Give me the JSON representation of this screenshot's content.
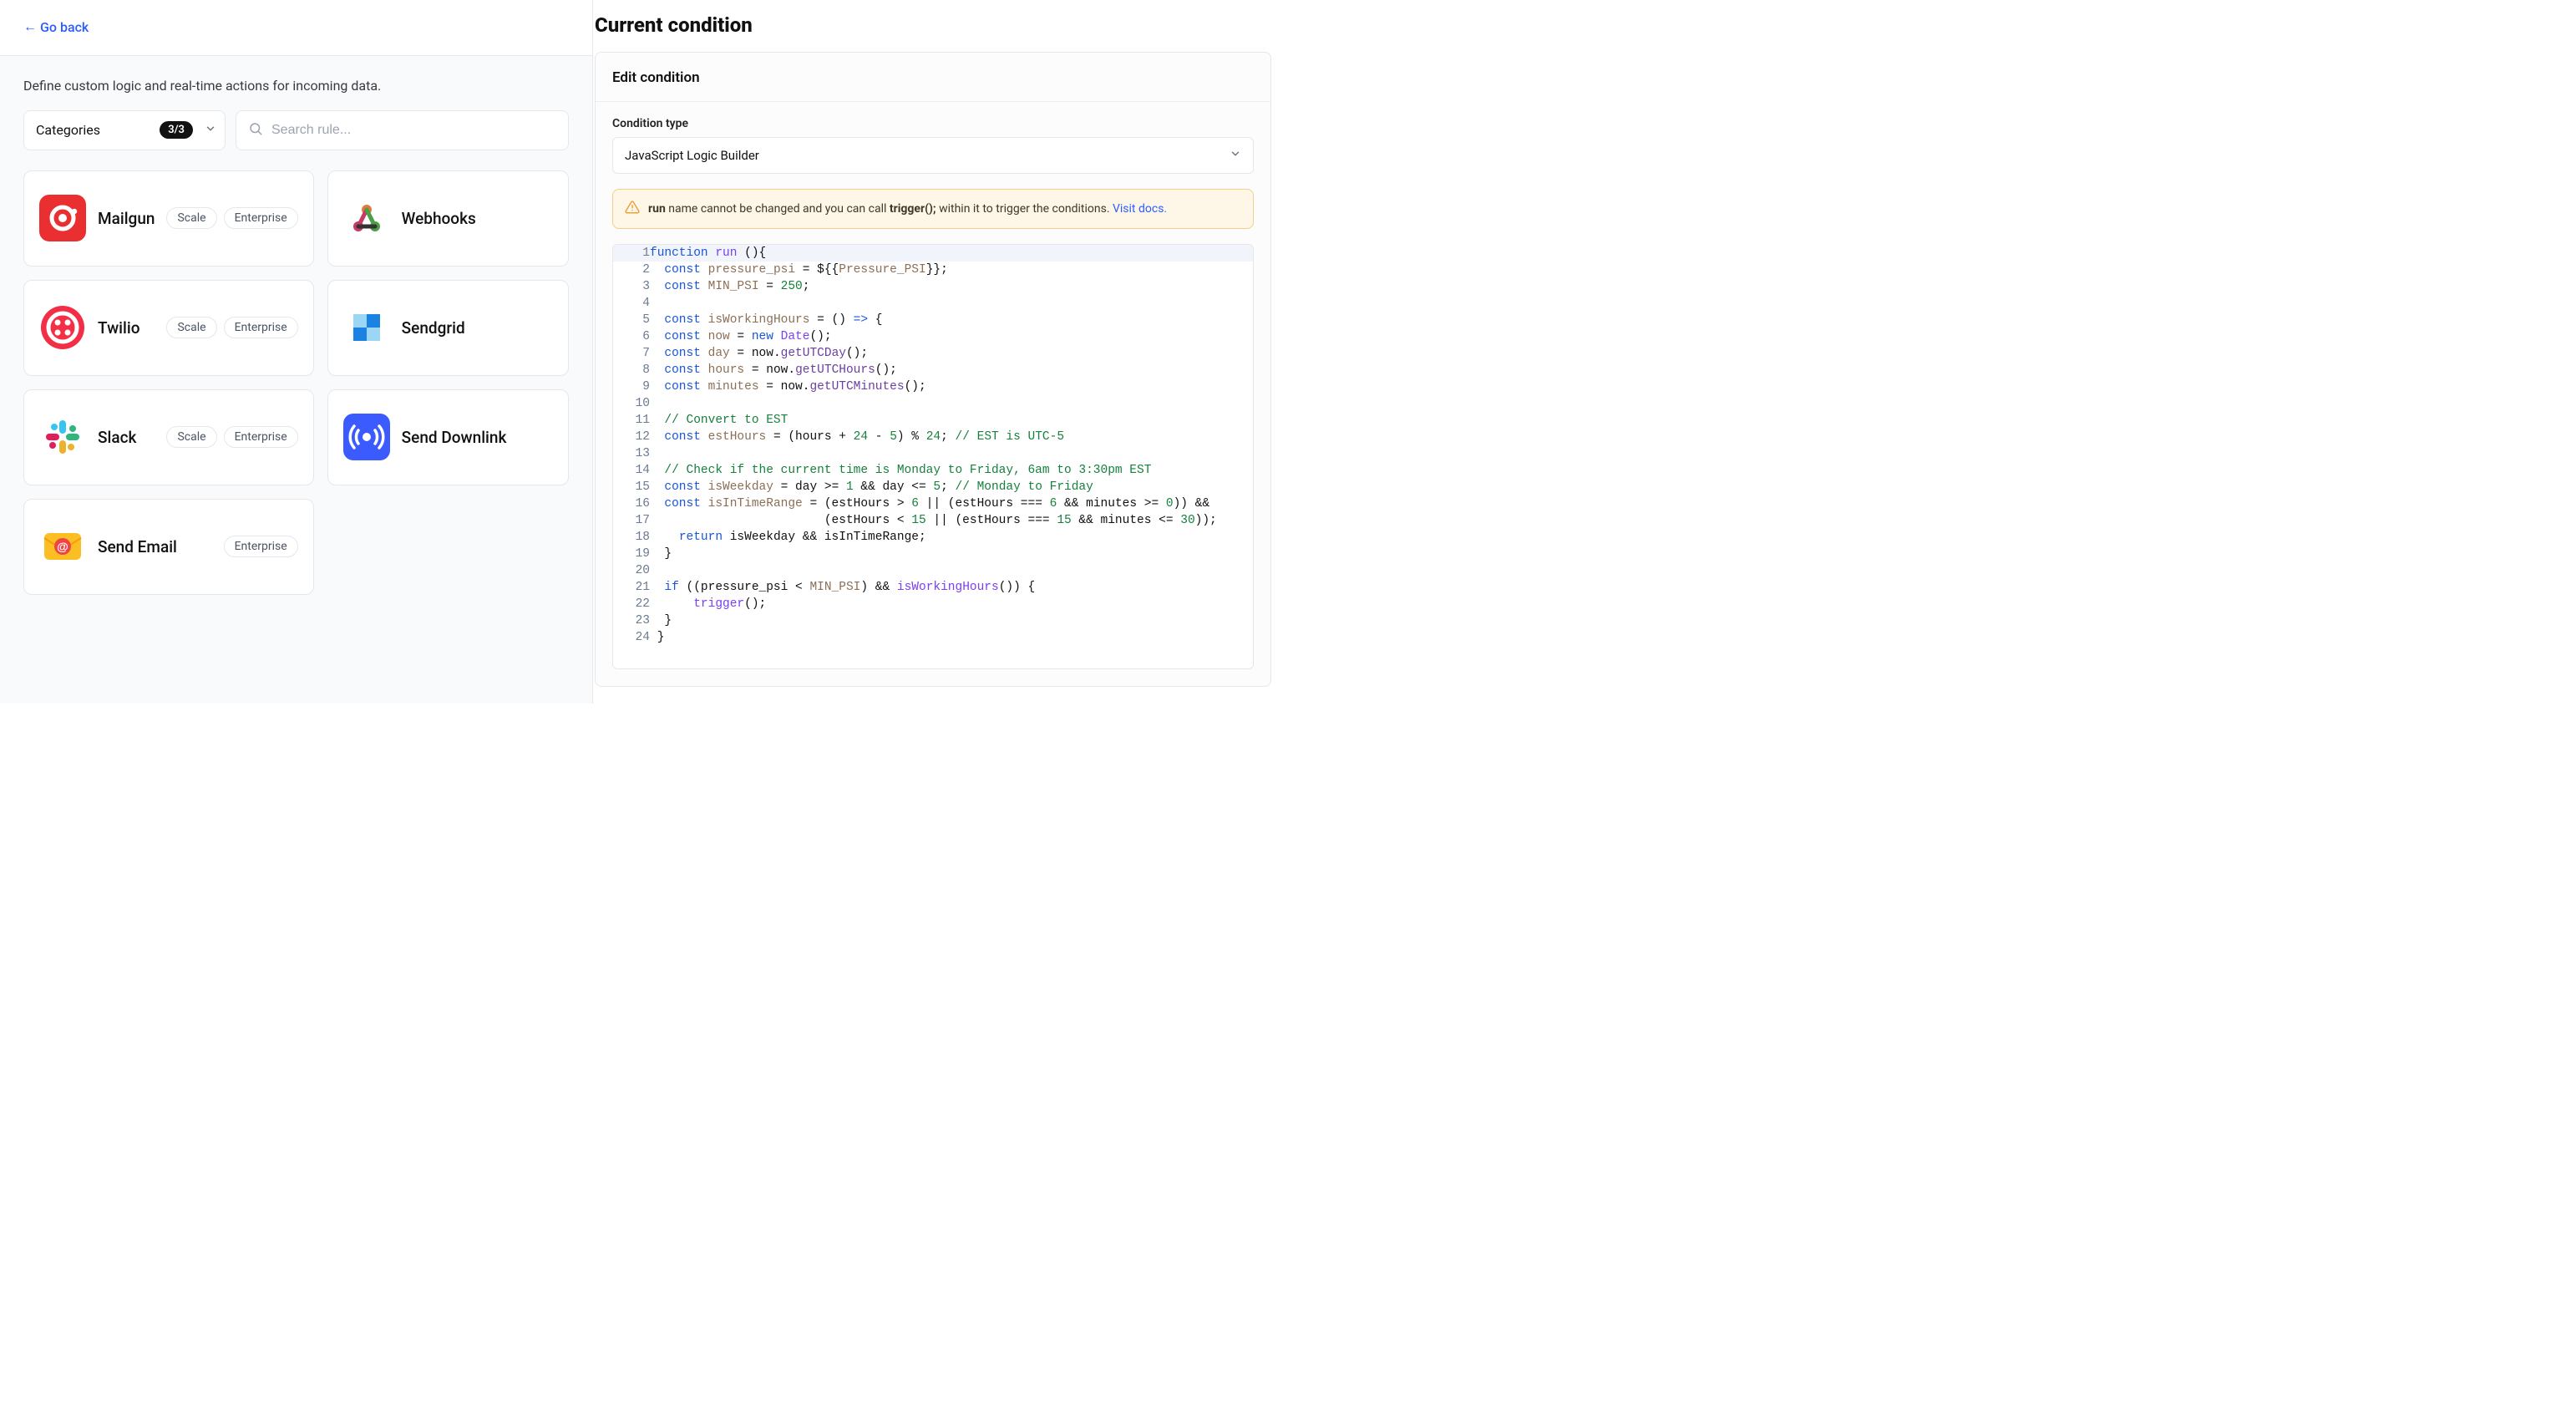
{
  "left": {
    "go_back": "Go back",
    "subtitle": "Define custom logic and real-time actions for incoming data.",
    "categories_label": "Categories",
    "categories_badge": "3/3",
    "search_placeholder": "Search rule...",
    "tags": {
      "scale": "Scale",
      "enterprise": "Enterprise"
    },
    "cards": [
      {
        "name": "Mailgun",
        "scale": true,
        "enterprise": true
      },
      {
        "name": "Webhooks",
        "scale": false,
        "enterprise": false
      },
      {
        "name": "Twilio",
        "scale": true,
        "enterprise": true
      },
      {
        "name": "Sendgrid",
        "scale": false,
        "enterprise": false
      },
      {
        "name": "Slack",
        "scale": true,
        "enterprise": true
      },
      {
        "name": "Send Downlink",
        "scale": false,
        "enterprise": false
      },
      {
        "name": "Send Email",
        "scale": false,
        "enterprise": true
      }
    ]
  },
  "right": {
    "title": "Current condition",
    "panel_header": "Edit condition",
    "condition_type_label": "Condition type",
    "condition_type_value": "JavaScript Logic Builder",
    "alert": {
      "pre": "run",
      "mid1": " name cannot be changed and you can call ",
      "bold2": "trigger();",
      "mid2": " within it to trigger the conditions. ",
      "link": "Visit docs."
    },
    "code_lines": [
      {
        "n": 1,
        "hl": true,
        "seg": [
          [
            "kw",
            "function"
          ],
          [
            "",
            " "
          ],
          [
            "fn",
            "run"
          ],
          [
            "",
            " (){"
          ]
        ]
      },
      {
        "n": 2,
        "seg": [
          [
            "",
            "  "
          ],
          [
            "kw",
            "const"
          ],
          [
            "",
            " "
          ],
          [
            "var",
            "pressure_psi"
          ],
          [
            "",
            " = ${{"
          ],
          [
            "var",
            "Pressure_PSI"
          ],
          [
            "",
            "}};"
          ]
        ]
      },
      {
        "n": 3,
        "seg": [
          [
            "",
            "  "
          ],
          [
            "kw",
            "const"
          ],
          [
            "",
            " "
          ],
          [
            "var",
            "MIN_PSI"
          ],
          [
            "",
            " = "
          ],
          [
            "num",
            "250"
          ],
          [
            "",
            ";"
          ]
        ]
      },
      {
        "n": 4,
        "seg": [
          [
            "",
            ""
          ]
        ]
      },
      {
        "n": 5,
        "seg": [
          [
            "",
            "  "
          ],
          [
            "kw",
            "const"
          ],
          [
            "",
            " "
          ],
          [
            "var",
            "isWorkingHours"
          ],
          [
            "",
            " = () "
          ],
          [
            "op",
            "=>"
          ],
          [
            "",
            " {"
          ]
        ]
      },
      {
        "n": 6,
        "seg": [
          [
            "",
            "  "
          ],
          [
            "kw",
            "const"
          ],
          [
            "",
            " "
          ],
          [
            "var",
            "now"
          ],
          [
            "",
            " = "
          ],
          [
            "new",
            "new"
          ],
          [
            "",
            " "
          ],
          [
            "fn",
            "Date"
          ],
          [
            "",
            "();"
          ]
        ]
      },
      {
        "n": 7,
        "seg": [
          [
            "",
            "  "
          ],
          [
            "kw",
            "const"
          ],
          [
            "",
            " "
          ],
          [
            "var",
            "day"
          ],
          [
            "",
            " = now."
          ],
          [
            "meth",
            "getUTCDay"
          ],
          [
            "",
            "();"
          ]
        ]
      },
      {
        "n": 8,
        "seg": [
          [
            "",
            "  "
          ],
          [
            "kw",
            "const"
          ],
          [
            "",
            " "
          ],
          [
            "var",
            "hours"
          ],
          [
            "",
            " = now."
          ],
          [
            "meth",
            "getUTCHours"
          ],
          [
            "",
            "();"
          ]
        ]
      },
      {
        "n": 9,
        "seg": [
          [
            "",
            "  "
          ],
          [
            "kw",
            "const"
          ],
          [
            "",
            " "
          ],
          [
            "var",
            "minutes"
          ],
          [
            "",
            " = now."
          ],
          [
            "meth",
            "getUTCMinutes"
          ],
          [
            "",
            "();"
          ]
        ]
      },
      {
        "n": 10,
        "seg": [
          [
            "",
            ""
          ]
        ]
      },
      {
        "n": 11,
        "seg": [
          [
            "",
            "  "
          ],
          [
            "com",
            "// Convert to EST"
          ]
        ]
      },
      {
        "n": 12,
        "seg": [
          [
            "",
            "  "
          ],
          [
            "kw",
            "const"
          ],
          [
            "",
            " "
          ],
          [
            "var",
            "estHours"
          ],
          [
            "",
            " = (hours + "
          ],
          [
            "num",
            "24"
          ],
          [
            "",
            " - "
          ],
          [
            "num",
            "5"
          ],
          [
            "",
            ") % "
          ],
          [
            "num",
            "24"
          ],
          [
            "",
            "; "
          ],
          [
            "com",
            "// EST is UTC-5"
          ]
        ]
      },
      {
        "n": 13,
        "seg": [
          [
            "",
            ""
          ]
        ]
      },
      {
        "n": 14,
        "seg": [
          [
            "",
            "  "
          ],
          [
            "com",
            "// Check if the current time is Monday to Friday, 6am to 3:30pm EST"
          ]
        ]
      },
      {
        "n": 15,
        "seg": [
          [
            "",
            "  "
          ],
          [
            "kw",
            "const"
          ],
          [
            "",
            " "
          ],
          [
            "var",
            "isWeekday"
          ],
          [
            "",
            " = day >= "
          ],
          [
            "num",
            "1"
          ],
          [
            "",
            " && day <= "
          ],
          [
            "num",
            "5"
          ],
          [
            "",
            "; "
          ],
          [
            "com",
            "// Monday to Friday"
          ]
        ]
      },
      {
        "n": 16,
        "seg": [
          [
            "",
            "  "
          ],
          [
            "kw",
            "const"
          ],
          [
            "",
            " "
          ],
          [
            "var",
            "isInTimeRange"
          ],
          [
            "",
            " = (estHours > "
          ],
          [
            "num",
            "6"
          ],
          [
            "",
            " || (estHours === "
          ],
          [
            "num",
            "6"
          ],
          [
            "",
            " && minutes >= "
          ],
          [
            "num",
            "0"
          ],
          [
            "",
            ")) &&"
          ]
        ]
      },
      {
        "n": 17,
        "seg": [
          [
            "",
            "                        (estHours < "
          ],
          [
            "num",
            "15"
          ],
          [
            "",
            " || (estHours === "
          ],
          [
            "num",
            "15"
          ],
          [
            "",
            " && minutes <= "
          ],
          [
            "num",
            "30"
          ],
          [
            "",
            "));"
          ]
        ]
      },
      {
        "n": 18,
        "seg": [
          [
            "",
            "    "
          ],
          [
            "kw",
            "return"
          ],
          [
            "",
            " isWeekday && isInTimeRange;"
          ]
        ]
      },
      {
        "n": 19,
        "seg": [
          [
            "",
            "  }"
          ]
        ]
      },
      {
        "n": 20,
        "seg": [
          [
            "",
            ""
          ]
        ]
      },
      {
        "n": 21,
        "seg": [
          [
            "",
            "  "
          ],
          [
            "kw",
            "if"
          ],
          [
            "",
            " ((pressure_psi < "
          ],
          [
            "var",
            "MIN_PSI"
          ],
          [
            "",
            ") && "
          ],
          [
            "fn",
            "isWorkingHours"
          ],
          [
            "",
            "()) {"
          ]
        ]
      },
      {
        "n": 22,
        "seg": [
          [
            "",
            "      "
          ],
          [
            "fn",
            "trigger"
          ],
          [
            "",
            "();"
          ]
        ]
      },
      {
        "n": 23,
        "seg": [
          [
            "",
            "  }"
          ]
        ]
      },
      {
        "n": 24,
        "seg": [
          [
            "",
            " }"
          ]
        ]
      }
    ]
  }
}
